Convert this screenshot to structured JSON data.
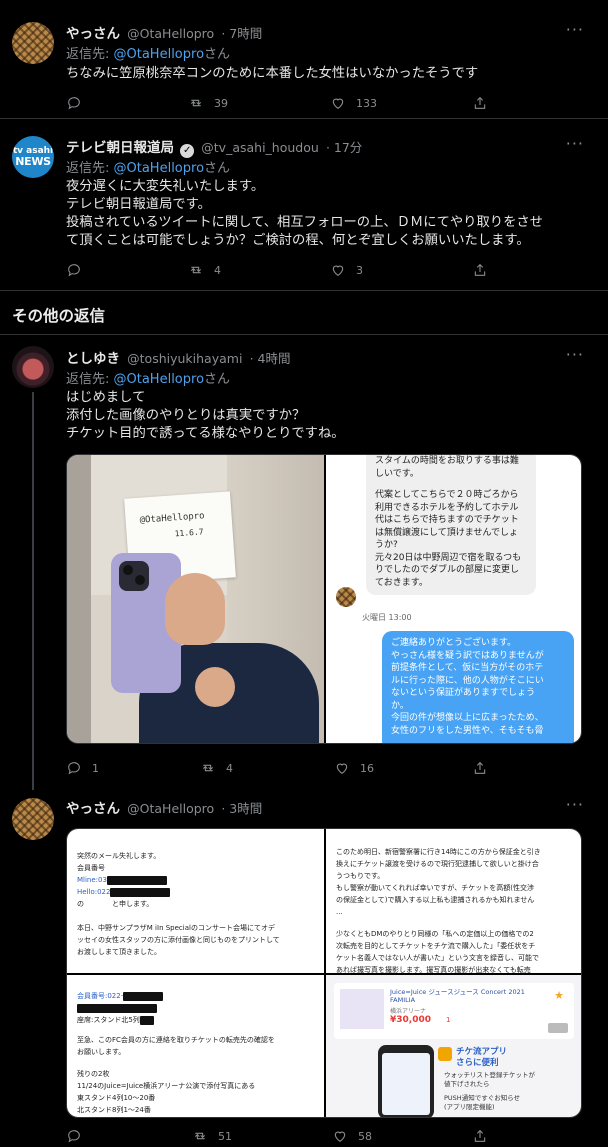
{
  "tweets": [
    {
      "name": "やっさん",
      "handle": "@OtaHellopro",
      "time": "· 7時間",
      "reply_prefix": "返信先: ",
      "reply_handle": "@OtaHellopro",
      "reply_suffix": "さん",
      "lines": [
        "ちなみに笠原桃奈卒コンのために本番した女性はいなかったそうです"
      ],
      "retweets": "39",
      "likes": "133"
    },
    {
      "name": "テレビ朝日報道局",
      "verified": "✓",
      "handle": "@tv_asahi_houdou",
      "time": "· 17分",
      "avatar_line1": "tv asahi",
      "avatar_line2": "NEWS",
      "reply_prefix": "返信先: ",
      "reply_handle": "@OtaHellopro",
      "reply_suffix": "さん",
      "lines": [
        "夜分遅くに大変失礼いたします。",
        "テレビ朝日報道局です。",
        "投稿されているツイートに関して、相互フォローの上、ＤＭにてやり取りをさせ",
        "て頂くことは可能でしょうか？ご検討の程、何とぞ宜しくお願いいたします。"
      ],
      "retweets": "4",
      "likes": "3"
    },
    {
      "name": "としゆき",
      "handle": "@toshiyukihayami",
      "time": "· 4時間",
      "reply_prefix": "返信先: ",
      "reply_handle": "@OtaHellopro",
      "reply_suffix": "さん",
      "lines": [
        "はじめまして",
        "添付した画像のやりとりは真実ですか？",
        "チケット目的で誘ってる様なやりとりですね。"
      ],
      "replies": "1",
      "retweets": "4",
      "likes": "16"
    },
    {
      "name": "やっさん",
      "handle": "@OtaHellopro",
      "time": "· 3時間",
      "retweets": "51",
      "likes": "58"
    }
  ],
  "section_title": "その他の返信",
  "more_glyph": "···",
  "media1": {
    "paper_text_1": "@OtaHellopro",
    "paper_text_2": "11.6.7",
    "chat_top": [
      "スタイムの時間をお取りする事は難",
      "しいです。",
      "",
      "代案としてこちらで２０時ごろから",
      "利用できるホテルを予約してホテル",
      "代はこちらで持ちますのでチケット",
      "は無償譲渡にして頂けませんでしょ",
      "うか?",
      "元々20日は中野周辺で宿を取るつも",
      "りでしたのでダブルの部屋に変更し",
      "ておきます。"
    ],
    "chat_time": "火曜日 13:00",
    "chat_blue": [
      "ご連絡ありがとうございます。",
      "やっさん様を疑う訳ではありませんが",
      "前提条件として、仮に当方がそのホテ",
      "ルに行った際に、他の人物がそこにい",
      "ないという保証がありますでしょう",
      "か。",
      "今回の件が想像以上に広まったため、",
      "女性のフリをした男性や、そもそも脅"
    ]
  },
  "media2": {
    "doc1": [
      "突然のメール失礼します。",
      "会員番号",
      "Mline:03",
      "Hello:022",
      "の　　　　と申します。",
      "",
      "本日、中野サンプラザM iIn Specialのコンサート会場にてオデ",
      "ッセイの女性スタッフの方に添付画像と同じものをプリントして",
      "お渡ししまて頂きました。"
    ],
    "doc2": [
      "このため明日、新宿警察署に行き14時にこの方から保証金と引き",
      "換えにチケット譲渡を受けるので現行犯逮捕して欲しいと掛け合",
      "うつもりです。",
      "もし警察が動いてくれれば幸いですが、チケットを高額(性交渉",
      "の保証金として)で購入する以上私も逮捕されるかも知れません",
      "...",
      "",
      "少なくともDMのやりとり同様の「私への定価以上の価格での2",
      "次転売を目的としてチケットをチケ流で購入した」「委任状をチ",
      "ケット名義人ではない人が書いた」という文言を録音し、可能で",
      "あれば撮写真を撮影します。撮写真の撮影が出来なくても転売"
    ],
    "doc3": [
      "会員番号:022-",
      "座席:スタンド北5列",
      "",
      "至急、このFC会員の方に連絡を取りチケットの転売先の確認を",
      "お願いします。",
      "",
      "残りの2枚",
      "11/24のJuice=Juice横浜アリーナ公演で添付写真にある",
      "東スタンド4列10〜20番",
      "北スタンド8列1〜24番"
    ],
    "app_title": "Juice=Juice ジュースジュース Concert 2021 FAMILIA",
    "app_venue": "横浜アリーナ",
    "app_price": "¥30,000",
    "app_qty": "1",
    "app_promo_1": "チケ流アプリ",
    "app_promo_2": "さらに便利",
    "app_promo_3": "ウォッチリスト登録チケットが",
    "app_promo_4": "値下げされたら",
    "app_promo_5": "PUSH通知ですぐお知らせ",
    "app_promo_6": "(アプリ限定機能)"
  }
}
